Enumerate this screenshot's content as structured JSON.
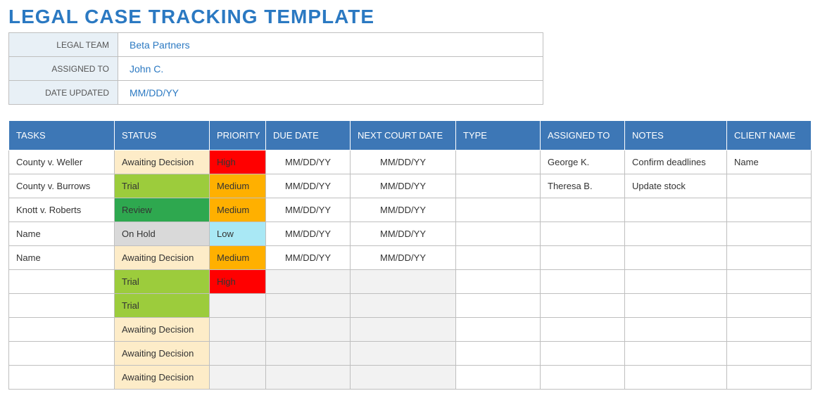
{
  "title": "LEGAL CASE TRACKING TEMPLATE",
  "meta": {
    "legal_team_label": "LEGAL TEAM",
    "legal_team_value": "Beta Partners",
    "assigned_to_label": "ASSIGNED TO",
    "assigned_to_value": "John C.",
    "date_updated_label": "DATE UPDATED",
    "date_updated_value": "MM/DD/YY"
  },
  "columns": {
    "tasks": "TASKS",
    "status": "STATUS",
    "priority": "PRIORITY",
    "due_date": "DUE DATE",
    "next_court": "NEXT COURT DATE",
    "type": "TYPE",
    "assigned_to": "ASSIGNED TO",
    "notes": "NOTES",
    "client_name": "CLIENT NAME"
  },
  "rows": [
    {
      "task": "County v. Weller",
      "status": "Awaiting Decision",
      "status_class": "status-awaiting",
      "priority": "High",
      "priority_class": "priority-high",
      "due_date": "MM/DD/YY",
      "next_court": "MM/DD/YY",
      "type": "",
      "assigned_to": "George K.",
      "notes": "Confirm deadlines",
      "client_name": "Name"
    },
    {
      "task": "County v. Burrows",
      "status": "Trial",
      "status_class": "status-trial",
      "priority": "Medium",
      "priority_class": "priority-medium",
      "due_date": "MM/DD/YY",
      "next_court": "MM/DD/YY",
      "type": "",
      "assigned_to": "Theresa B.",
      "notes": "Update stock",
      "client_name": ""
    },
    {
      "task": "Knott v. Roberts",
      "status": "Review",
      "status_class": "status-review",
      "priority": "Medium",
      "priority_class": "priority-medium",
      "due_date": "MM/DD/YY",
      "next_court": "MM/DD/YY",
      "type": "",
      "assigned_to": "",
      "notes": "",
      "client_name": ""
    },
    {
      "task": "Name",
      "status": "On Hold",
      "status_class": "status-onhold",
      "priority": "Low",
      "priority_class": "priority-low",
      "due_date": "MM/DD/YY",
      "next_court": "MM/DD/YY",
      "type": "",
      "assigned_to": "",
      "notes": "",
      "client_name": ""
    },
    {
      "task": "Name",
      "status": "Awaiting Decision",
      "status_class": "status-awaiting",
      "priority": "Medium",
      "priority_class": "priority-medium",
      "due_date": "MM/DD/YY",
      "next_court": "MM/DD/YY",
      "type": "",
      "assigned_to": "",
      "notes": "",
      "client_name": ""
    },
    {
      "task": "",
      "status": "Trial",
      "status_class": "status-trial",
      "priority": "High",
      "priority_class": "priority-high",
      "due_date": "",
      "next_court": "",
      "type": "",
      "assigned_to": "",
      "notes": "",
      "client_name": ""
    },
    {
      "task": "",
      "status": "Trial",
      "status_class": "status-trial",
      "priority": "",
      "priority_class": "priority-empty",
      "due_date": "",
      "next_court": "",
      "type": "",
      "assigned_to": "",
      "notes": "",
      "client_name": ""
    },
    {
      "task": "",
      "status": "Awaiting Decision",
      "status_class": "status-awaiting",
      "priority": "",
      "priority_class": "priority-empty",
      "due_date": "",
      "next_court": "",
      "type": "",
      "assigned_to": "",
      "notes": "",
      "client_name": ""
    },
    {
      "task": "",
      "status": "Awaiting Decision",
      "status_class": "status-awaiting",
      "priority": "",
      "priority_class": "priority-empty",
      "due_date": "",
      "next_court": "",
      "type": "",
      "assigned_to": "",
      "notes": "",
      "client_name": ""
    },
    {
      "task": "",
      "status": "Awaiting Decision",
      "status_class": "status-awaiting",
      "priority": "",
      "priority_class": "priority-empty",
      "due_date": "",
      "next_court": "",
      "type": "",
      "assigned_to": "",
      "notes": "",
      "client_name": ""
    }
  ]
}
